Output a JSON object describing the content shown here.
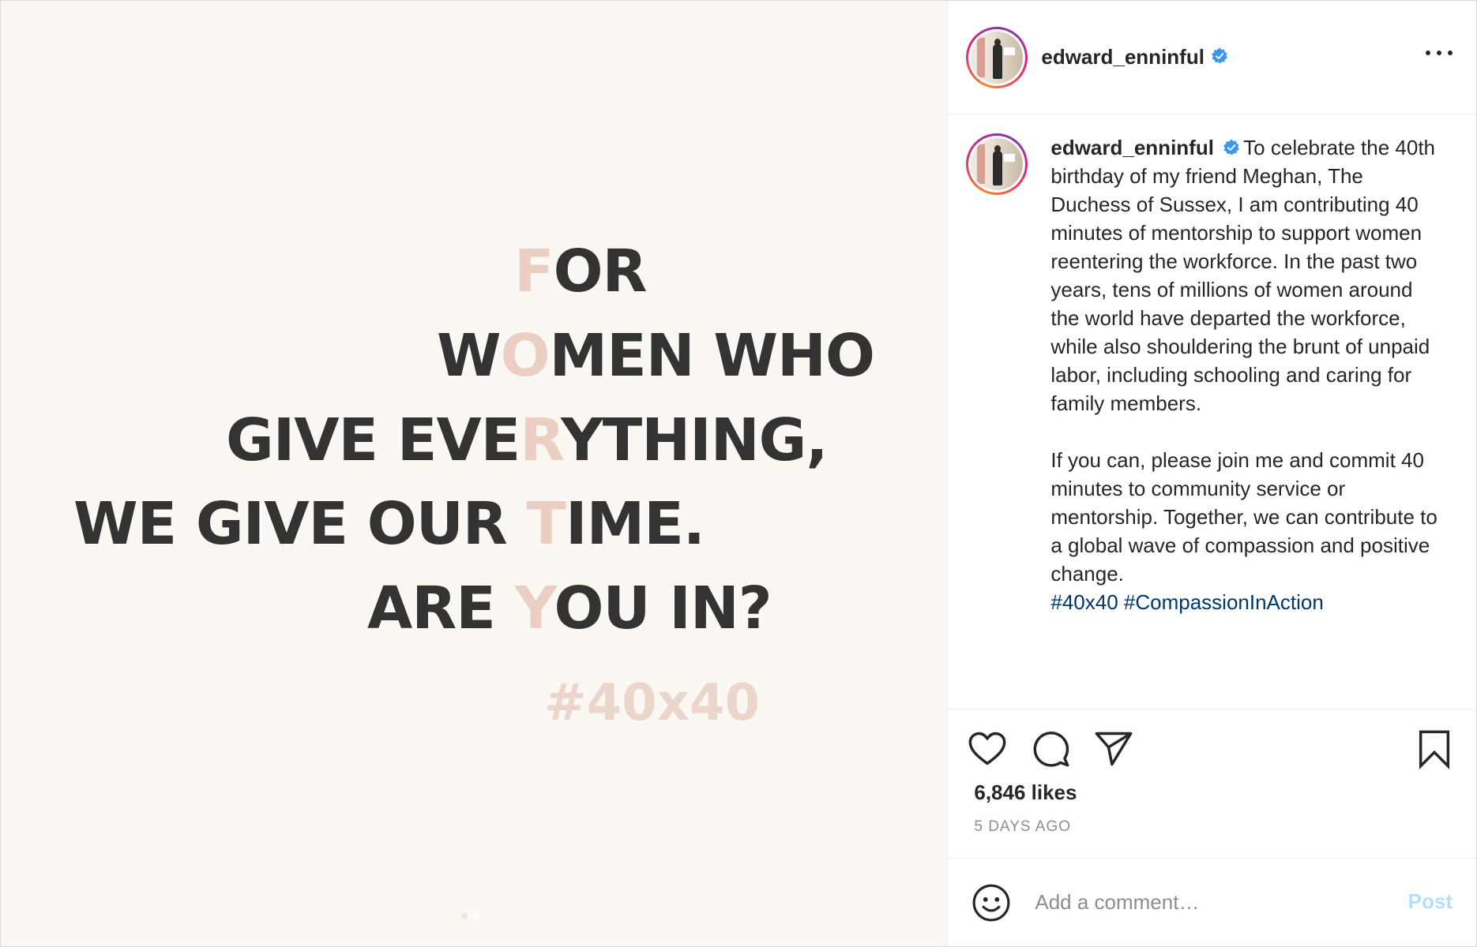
{
  "post_image": {
    "lines": [
      {
        "before": "",
        "accent": "F",
        "after": "OR"
      },
      {
        "before": "W",
        "accent": "O",
        "after": "MEN WHO"
      },
      {
        "before": "GIVE EVE",
        "accent": "R",
        "after": "YTHING,"
      },
      {
        "before": "WE GIVE OUR ",
        "accent": "T",
        "after": "IME."
      },
      {
        "before": "ARE ",
        "accent": "Y",
        "after": "OU IN?"
      }
    ],
    "hashtag": "#40x40",
    "carousel": {
      "count": 2,
      "active_index": 2
    },
    "colors": {
      "background": "#fbf7f2",
      "text": "#333333",
      "accent": "#ebcfc2"
    }
  },
  "header": {
    "username": "edward_enninful",
    "verified": true
  },
  "caption": {
    "username": "edward_enninful",
    "paragraph1": "To celebrate the 40th birthday of my friend Meghan, The Duchess of Sussex, I am contributing 40 minutes of mentorship to support women reentering the workforce. In the past two years, tens of millions of women around the world have departed the workforce, while also shouldering the brunt of unpaid labor, including schooling and caring for family members.",
    "paragraph2": "If you can, please join me and commit 40 minutes to community service or mentorship. Together, we can contribute to a global wave of compassion and positive change.",
    "hashtags": [
      "#40x40",
      "#CompassionInAction"
    ]
  },
  "actions": {
    "icons": [
      "heart-icon",
      "comment-icon",
      "share-icon",
      "bookmark-icon"
    ]
  },
  "likes": "6,846 likes",
  "time_ago": "5 DAYS AGO",
  "comment": {
    "placeholder": "Add a comment…",
    "value": "",
    "post_label": "Post"
  },
  "colors": {
    "verified": "#3897f0",
    "hashtag_link": "#00376b",
    "post_disabled": "#b2dffc",
    "muted": "#8e8e8e"
  }
}
